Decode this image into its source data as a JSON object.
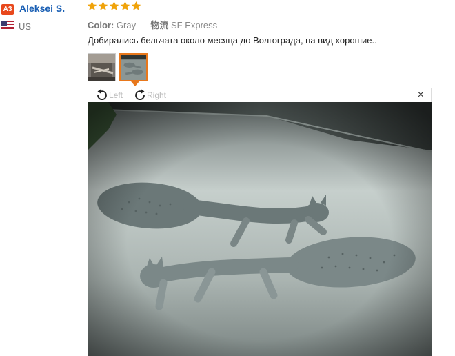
{
  "reviewer": {
    "avatar_initials": "A3",
    "name": "Aleksei S.",
    "country_code": "US",
    "country": "US",
    "flag_icon": "us-flag-icon"
  },
  "rating": {
    "stars": 5,
    "max": 5,
    "color": "#f0a30a"
  },
  "meta": {
    "color_label": "Color:",
    "color_value": "Gray",
    "shipping_label": "物流",
    "shipping_value": "SF Express"
  },
  "review_text": "Добирались бельчата около месяца до Волгограда, на вид хорошие..",
  "thumbnails": [
    {
      "icon": "review-photo-1-thumbnail",
      "active": false
    },
    {
      "icon": "review-photo-2-thumbnail",
      "active": true
    }
  ],
  "viewer": {
    "rotate_left_label": "Left",
    "rotate_right_label": "Right",
    "close_label": "×"
  },
  "colors": {
    "accent": "#e8781c",
    "link": "#1a5fb4",
    "avatar_bg": "#e8481c"
  }
}
